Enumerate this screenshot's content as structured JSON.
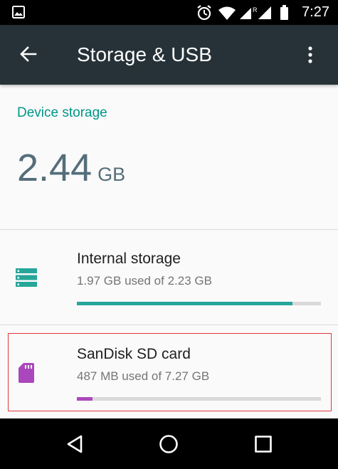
{
  "status_bar": {
    "time": "7:27",
    "icons": [
      "gallery-icon",
      "alarm-icon",
      "wifi-icon",
      "signal-roaming-icon",
      "signal-icon",
      "battery-icon"
    ],
    "roaming_label": "R"
  },
  "app_bar": {
    "title": "Storage & USB",
    "back_icon": "arrow-back-icon",
    "menu_icon": "more-vert-icon"
  },
  "device_storage": {
    "header": "Device storage",
    "total_value": "2.44",
    "total_unit": "GB"
  },
  "volumes": [
    {
      "name": "Internal storage",
      "summary": "1.97 GB used of 2.23 GB",
      "icon": "storage-icon",
      "used_fraction": 0.883,
      "color": "#26a69a"
    },
    {
      "name": "SanDisk SD card",
      "summary": "487 MB used of 7.27 GB",
      "icon": "sd-card-icon",
      "used_fraction": 0.065,
      "color": "#ab47bc"
    }
  ],
  "nav_bar": {
    "buttons": [
      "back-triangle-icon",
      "home-circle-icon",
      "recents-square-icon"
    ]
  },
  "colors": {
    "app_bar": "#263238",
    "accent": "#009688",
    "highlight_border": "#e23a3a"
  }
}
